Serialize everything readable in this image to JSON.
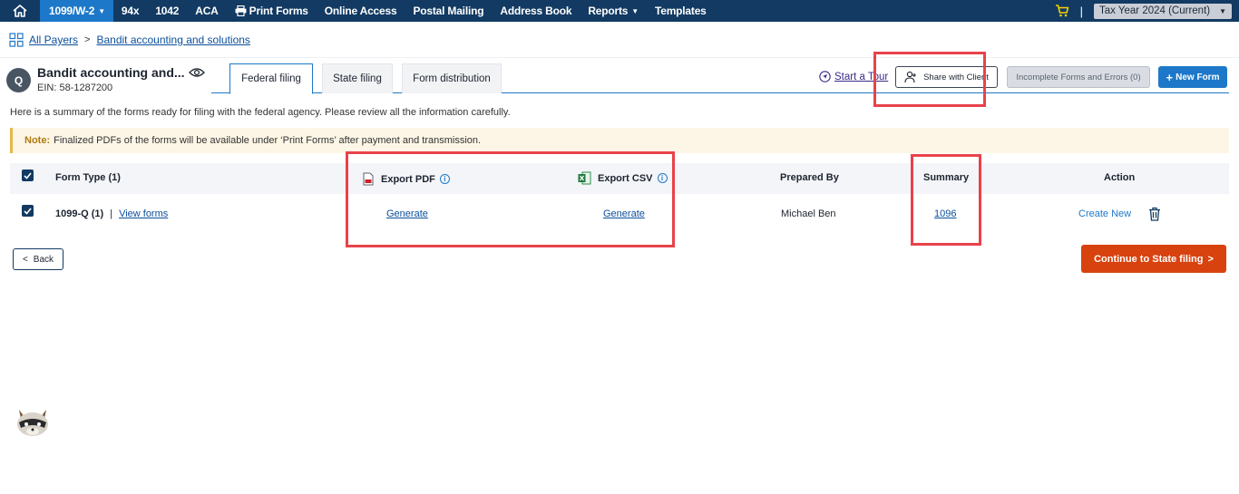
{
  "nav": {
    "items": [
      {
        "label": "1099/W-2",
        "active": true,
        "caret": true
      },
      {
        "label": "94x"
      },
      {
        "label": "1042"
      },
      {
        "label": "ACA"
      },
      {
        "label": "Print Forms",
        "icon": "printer-icon"
      },
      {
        "label": "Online Access"
      },
      {
        "label": "Postal Mailing"
      },
      {
        "label": "Address Book"
      },
      {
        "label": "Reports",
        "caret": true
      },
      {
        "label": "Templates"
      }
    ],
    "separator": "|",
    "tax_year": "Tax Year 2024 (Current)"
  },
  "breadcrumb": {
    "root": "All Payers",
    "current": "Bandit accounting and solutions"
  },
  "payer": {
    "initial": "Q",
    "name": "Bandit accounting and...",
    "ein": "EIN: 58-1287200"
  },
  "tabs": [
    {
      "label": "Federal filing",
      "active": true
    },
    {
      "label": "State filing"
    },
    {
      "label": "Form distribution"
    }
  ],
  "actions": {
    "tour": "Start a Tour",
    "share": "Share with Client",
    "incomplete": "Incomplete Forms and Errors (0)",
    "new_form": "New Form"
  },
  "summary_text": "Here is a summary of the forms ready for filing with the federal agency. Please review all the information carefully.",
  "note": {
    "label": "Note:",
    "text": "Finalized PDFs of the forms will be available under ‘Print Forms’ after payment and transmission."
  },
  "table": {
    "headers": {
      "form_type": "Form Type  (1)",
      "export_pdf": "Export PDF",
      "export_csv": "Export CSV",
      "prepared_by": "Prepared By",
      "summary": "Summary",
      "action": "Action"
    },
    "rows": [
      {
        "form": "1099-Q (1)",
        "divider": "|",
        "view": "View forms",
        "pdf": "Generate",
        "csv": "Generate",
        "prepared_by": "Michael Ben",
        "summary": "1096",
        "action": "Create New"
      }
    ]
  },
  "buttons": {
    "back": "Back",
    "continue": "Continue to State filing"
  },
  "colors": {
    "nav_bg": "#123a63",
    "accent": "#1d78c9",
    "continue": "#d8420f",
    "highlight": "#e8424a"
  }
}
